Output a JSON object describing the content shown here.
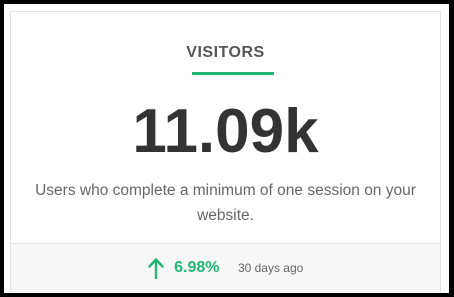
{
  "card": {
    "title": "VISITORS",
    "value": "11.09k",
    "description": "Users who complete a minimum of one session on your website.",
    "change": "6.98%",
    "change_direction": "up",
    "period": "30 days ago",
    "accent_color": "#22b573",
    "icons": {
      "change": "arrow-up-icon"
    }
  }
}
